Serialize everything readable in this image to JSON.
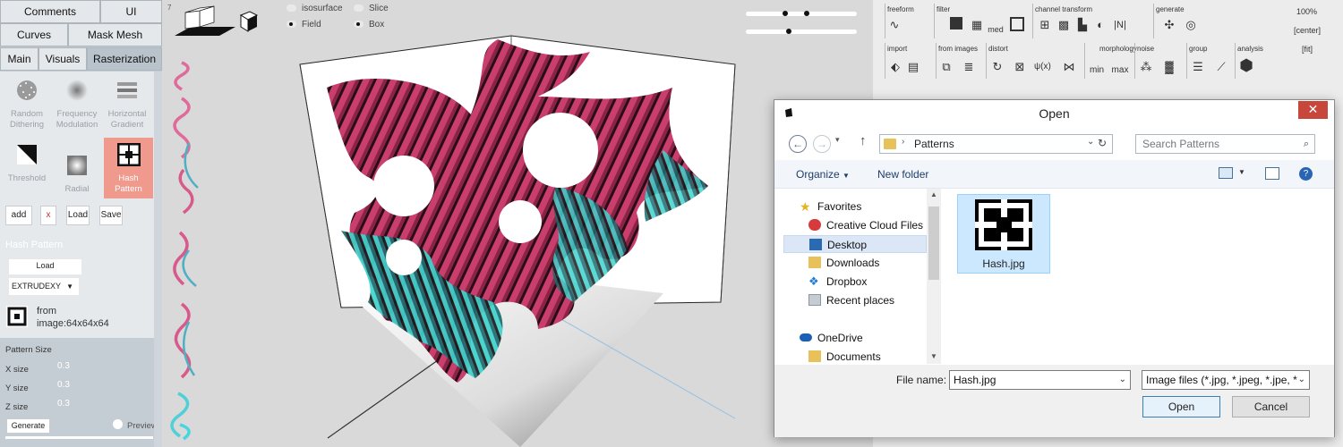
{
  "left_panel": {
    "top_tabs": [
      "Comments",
      "UI"
    ],
    "second_tabs": [
      "Curves",
      "Mask Mesh"
    ],
    "main_tabs": [
      "Main",
      "Visuals",
      "Rasterization"
    ],
    "active_tab": "Rasterization",
    "tools": [
      {
        "label": "Random Dithering",
        "icon": "random-dithering-icon"
      },
      {
        "label": "Frequency Modulation",
        "icon": "frequency-modulation-icon"
      },
      {
        "label": "Horizontal Gradient",
        "icon": "horizontal-gradient-icon"
      },
      {
        "label": "Threshold",
        "icon": "threshold-icon"
      },
      {
        "label": "Radial",
        "icon": "radial-icon"
      },
      {
        "label": "Hash Pattern",
        "icon": "hash-pattern-icon",
        "selected": true
      }
    ],
    "actions": {
      "add": "add",
      "remove": "x",
      "load": "Load",
      "save": "Save"
    },
    "pattern_panel": {
      "title": "Hash Pattern",
      "load": "Load",
      "mode": "EXTRUDEXY",
      "source_label": "from",
      "source_value": "image:64x64x64"
    },
    "pattern_size": {
      "title": "Pattern Size",
      "x_label": "X size",
      "x_value": "0.3",
      "y_label": "Y size",
      "y_value": "0.3",
      "z_label": "Z size",
      "z_value": "0.3",
      "generate": "Generate",
      "preview": "Preview"
    }
  },
  "viewport": {
    "corner_number": "7",
    "render_options": [
      {
        "label": "isosurface",
        "selected": false
      },
      {
        "label": "Slice",
        "selected": false
      },
      {
        "label": "Field",
        "selected": true
      },
      {
        "label": "Box",
        "selected": true
      }
    ],
    "sliders": [
      {
        "a": 0.35,
        "b": 0.55
      },
      {
        "a": 0.38
      }
    ]
  },
  "toolbar": {
    "groups_row1": [
      "freeform",
      "filter",
      "channel transform",
      "generate"
    ],
    "groups_row2": [
      "import",
      "from images",
      "distort",
      "morphology",
      "noise",
      "group",
      "analysis"
    ],
    "filter_labels": [
      "med"
    ],
    "transform_labels": [
      "ψ(x)"
    ],
    "morph_labels": [
      "min",
      "max"
    ],
    "zoom": "100%",
    "center": "[center]",
    "fit": "[fit]"
  },
  "dialog": {
    "title": "Open",
    "close": "✕",
    "path": "Patterns",
    "search_placeholder": "Search Patterns",
    "organize": "Organize",
    "new_folder": "New folder",
    "nav_items": [
      {
        "label": "Favorites",
        "icon": "star-icon"
      },
      {
        "label": "Creative Cloud Files",
        "icon": "creative-cloud-icon"
      },
      {
        "label": "Desktop",
        "icon": "desktop-icon",
        "selected": true
      },
      {
        "label": "Downloads",
        "icon": "downloads-folder-icon"
      },
      {
        "label": "Dropbox",
        "icon": "dropbox-icon"
      },
      {
        "label": "Recent places",
        "icon": "recent-places-icon"
      },
      {
        "label": "OneDrive",
        "icon": "onedrive-icon"
      },
      {
        "label": "Documents",
        "icon": "folder-icon"
      }
    ],
    "file": {
      "name": "Hash.jpg"
    },
    "file_name_label": "File name:",
    "file_name_value": "Hash.jpg",
    "file_type": "Image files (*.jpg, *.jpeg, *.jpe, *",
    "open": "Open",
    "cancel": "Cancel"
  }
}
